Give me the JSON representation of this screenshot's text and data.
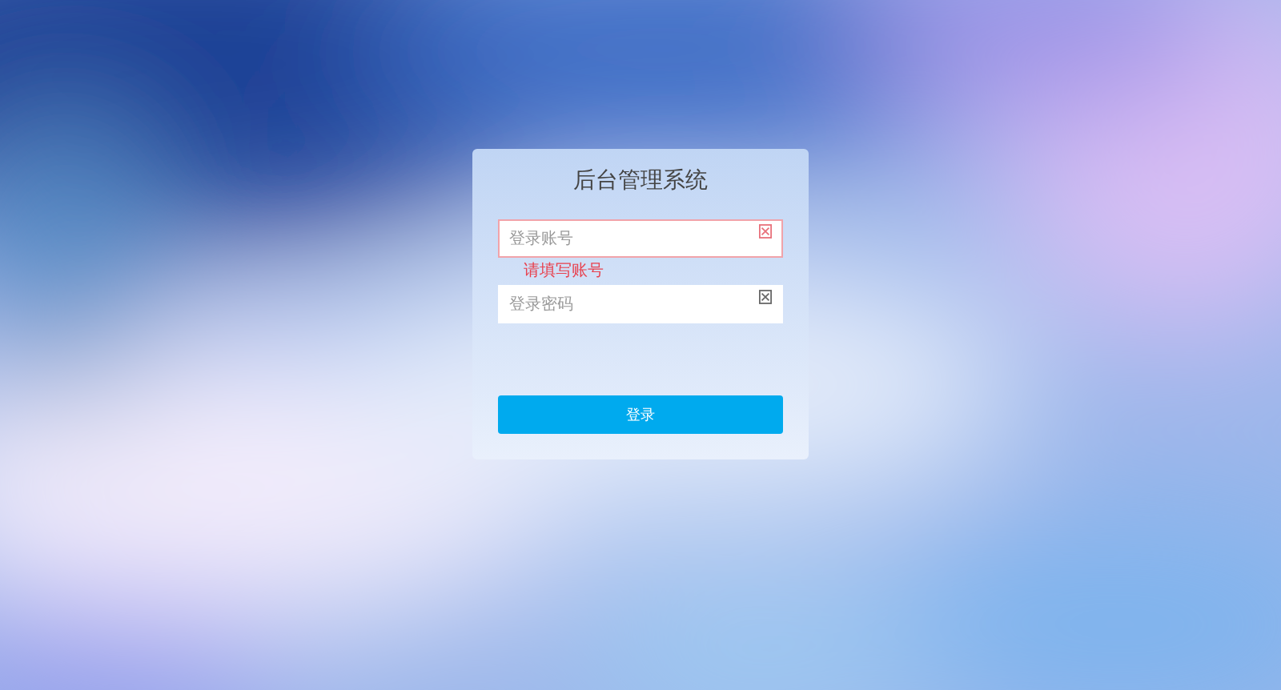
{
  "title": "后台管理系统",
  "fields": [
    {
      "placeholder": "登录账号",
      "invalid": true,
      "error": "请填写账号"
    },
    {
      "placeholder": "登录密码",
      "invalid": false
    }
  ],
  "button": "登录"
}
